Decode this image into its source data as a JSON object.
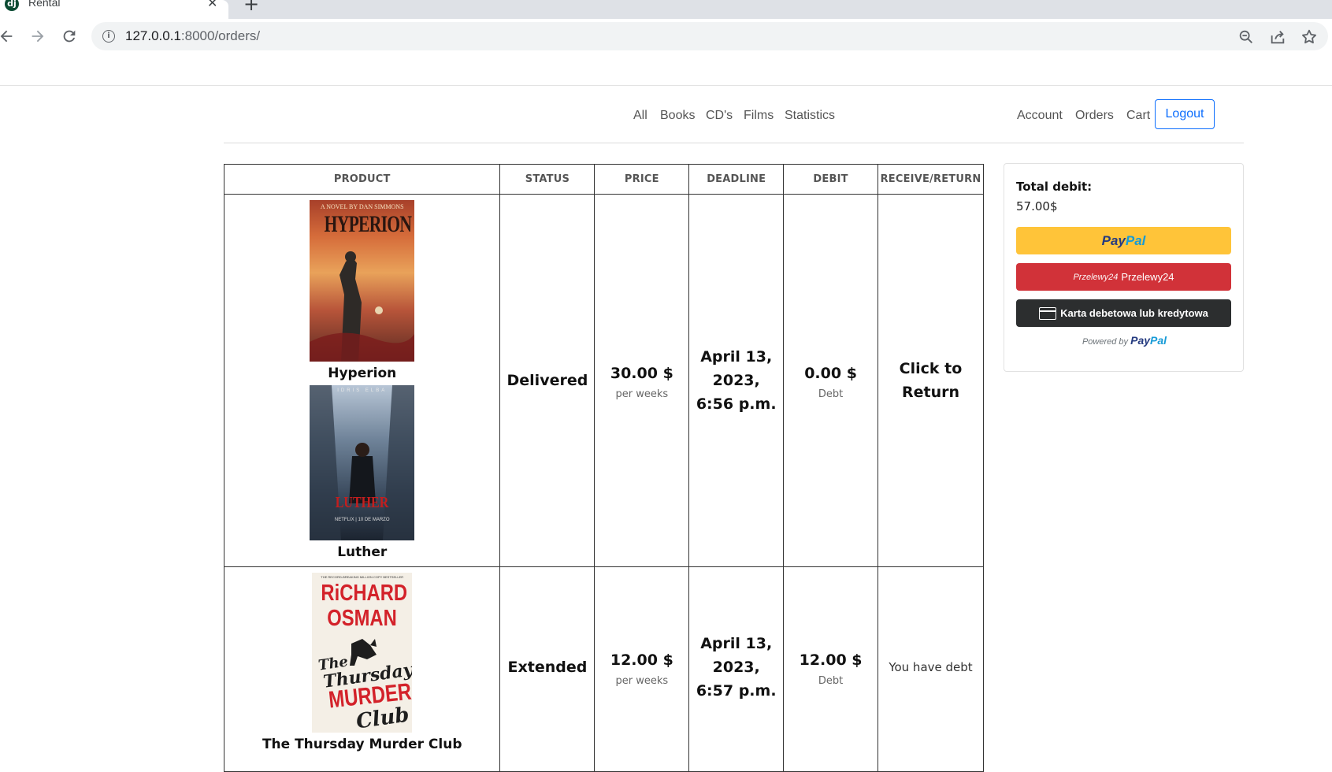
{
  "browser": {
    "tab_title": "Rental",
    "favicon_text": "dj",
    "url_host": "127.0.0.1",
    "url_rest": ":8000/orders/"
  },
  "navbar": {
    "center_links": [
      "All",
      "Books",
      "CD's",
      "Films",
      "Statistics"
    ],
    "right_links": [
      "Account",
      "Orders",
      "Cart"
    ],
    "logout": "Logout"
  },
  "table": {
    "headers": [
      "PRODUCT",
      "STATUS",
      "PRICE",
      "DEADLINE",
      "DEBIT",
      "RECEIVE/RETURN"
    ],
    "rows": [
      {
        "products": [
          "Hyperion",
          "Luther"
        ],
        "status": "Delivered",
        "price": "30.00 $",
        "price_unit": "per weeks",
        "deadline": "April 13, 2023, 6:56 p.m.",
        "debit": "0.00 $",
        "debit_label": "Debt",
        "action": "Click to Return"
      },
      {
        "products": [
          "The Thursday Murder Club"
        ],
        "status": "Extended",
        "price": "12.00 $",
        "price_unit": "per weeks",
        "deadline": "April 13, 2023, 6:57 p.m.",
        "debit": "12.00 $",
        "debit_label": "Debt",
        "action": "You have debt"
      }
    ]
  },
  "covers": {
    "hyperion": {
      "top_text": "A NOVEL BY DAN SIMMONS",
      "title": "HYPERION"
    },
    "luther": {
      "top_text": "IDRIS ELBA",
      "title": "LUTHER",
      "bottom_text": "NETFLIX | 10 DE MARZO"
    },
    "thursday": {
      "top_text": "THE RECORD-BREAKING MILLION COPY BESTSELLER",
      "author_1": "RiCHARD",
      "author_2": "OSMAN",
      "title_1": "The",
      "title_2": "Thursday",
      "title_3": "MURDER",
      "title_4": "Club"
    }
  },
  "payment": {
    "total_label": "Total debit:",
    "total_value": "57.00$",
    "paypal_1": "Pay",
    "paypal_2": "Pal",
    "p24_mark": "Przelewy24",
    "p24_label": "Przelewy24",
    "card_label": "Karta debetowa lub kredytowa",
    "powered_by": "Powered by"
  },
  "colors": {
    "accent": "#0d6efd",
    "paypal_yellow": "#ffc439",
    "p24_red": "#d13239",
    "card_dark": "#2c2e2f"
  }
}
